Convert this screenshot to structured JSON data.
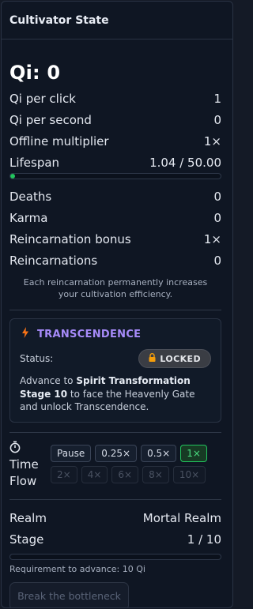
{
  "panel": {
    "title": "Cultivator State"
  },
  "qi": {
    "label": "Qi: 0"
  },
  "stats": [
    {
      "label": "Qi per click",
      "value": "1"
    },
    {
      "label": "Qi per second",
      "value": "0"
    },
    {
      "label": "Offline multiplier",
      "value": "1×"
    }
  ],
  "lifespan": {
    "label": "Lifespan",
    "value": "1.04 / 50.00",
    "progress_fraction": 0.021
  },
  "stats2": [
    {
      "label": "Deaths",
      "value": "0"
    },
    {
      "label": "Karma",
      "value": "0"
    },
    {
      "label": "Reincarnation bonus",
      "value": "1×"
    },
    {
      "label": "Reincarnations",
      "value": "0"
    }
  ],
  "reincarnation_note": "Each reincarnation permanently increases your cultivation efficiency.",
  "transcendence": {
    "title": "TRANSCENDENCE",
    "icon": "lightning-bolt-icon",
    "status_label": "Status:",
    "badge_icon": "lock-icon",
    "badge_text": "LOCKED",
    "advance_prefix": "Advance to ",
    "advance_bold": "Spirit Transformation Stage 10",
    "advance_suffix": " to face the Heavenly Gate and unlock Transcendence."
  },
  "time_flow": {
    "icon": "stopwatch-icon",
    "label_line1": "Time",
    "label_line2": "Flow",
    "pause_label": "Pause",
    "speeds": [
      {
        "label": "0.25×",
        "state": "enabled"
      },
      {
        "label": "0.5×",
        "state": "enabled"
      },
      {
        "label": "1×",
        "state": "active"
      },
      {
        "label": "2×",
        "state": "disabled"
      },
      {
        "label": "4×",
        "state": "disabled"
      },
      {
        "label": "6×",
        "state": "disabled"
      },
      {
        "label": "8×",
        "state": "disabled"
      },
      {
        "label": "10×",
        "state": "disabled"
      }
    ]
  },
  "realm": {
    "label": "Realm",
    "value": "Mortal Realm"
  },
  "stage": {
    "label": "Stage",
    "value": "1 / 10",
    "progress_fraction": 0
  },
  "requirement": "Requirement to advance: 10 Qi",
  "break_button": "Break the bottleneck",
  "colors": {
    "accent_purple": "#a78bfa",
    "bolt_orange": "#f97316",
    "active_green": "#22c55e",
    "panel_bg": "#0f1623"
  }
}
